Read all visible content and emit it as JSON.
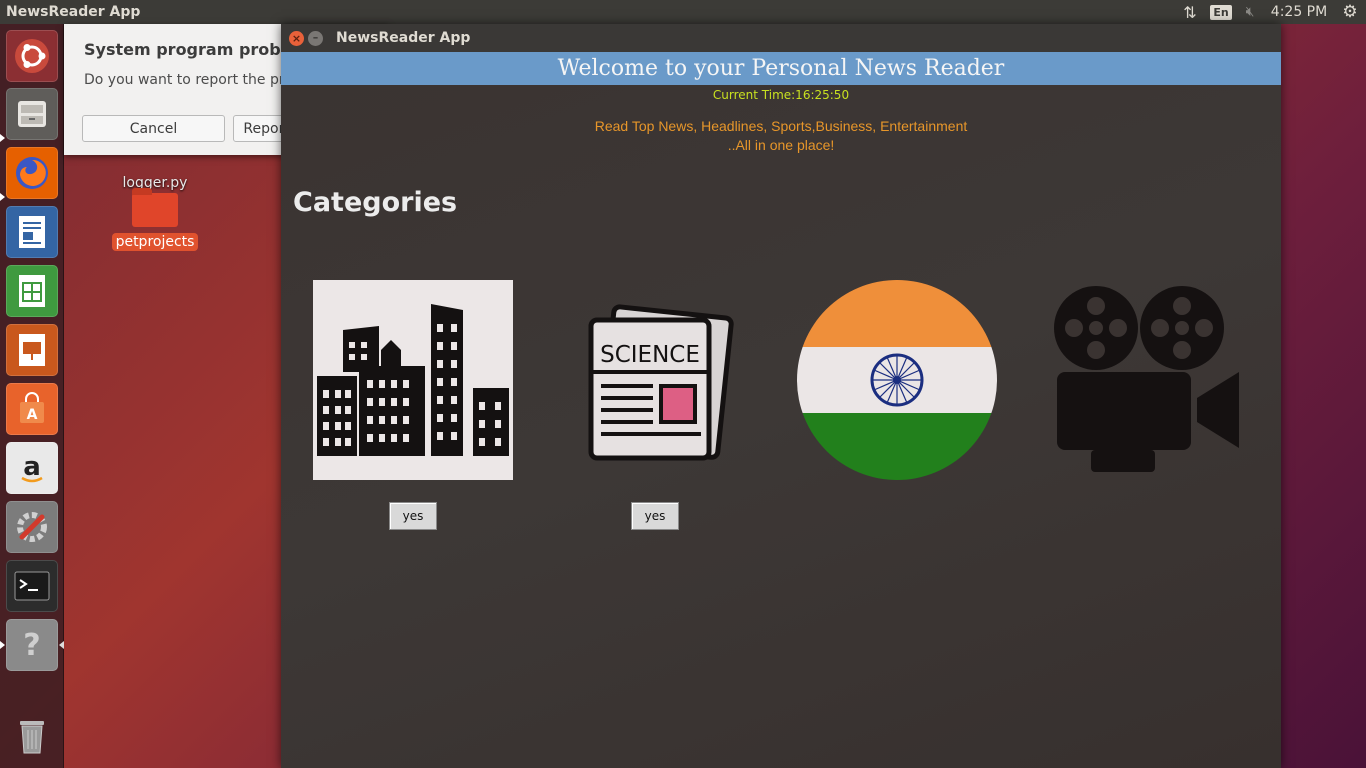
{
  "top_panel": {
    "app_title": "NewsReader App",
    "clock": "4:25 PM",
    "lang": "En"
  },
  "desktop": {
    "file_label": "logger.py",
    "folder_label": "petprojects"
  },
  "error_dialog": {
    "title": "System program problem detected",
    "message": "Do you want to report the problem now?",
    "cancel": "Cancel",
    "report": "Report problem..."
  },
  "window": {
    "title": "NewsReader App",
    "banner": "Welcome to your Personal News Reader",
    "current_time": "Current Time:16:25:50",
    "tagline1": "Read Top News, Headlines, Sports,Business, Entertainment",
    "tagline2": "..All in one place!",
    "categories_heading": "Categories",
    "science_label": "SCIENCE",
    "yes1": "yes",
    "yes2": "yes"
  },
  "colors": {
    "banner_bg": "#6a9ac9",
    "clock_text": "#c8e020",
    "tagline_text": "#e7962a"
  }
}
